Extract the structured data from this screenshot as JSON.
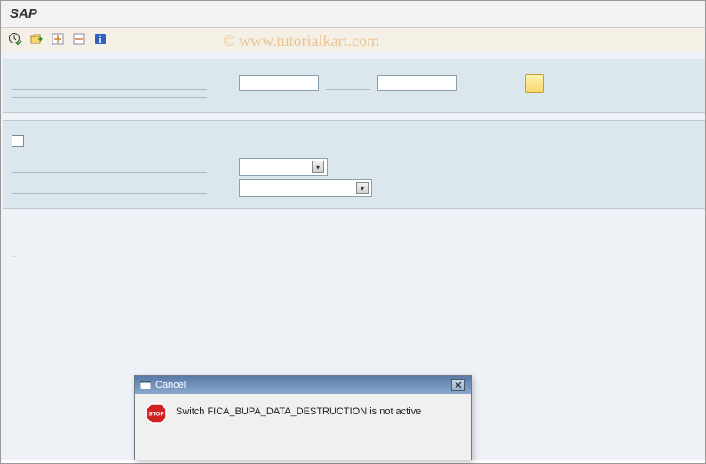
{
  "header": {
    "title": "SAP"
  },
  "watermark": "© www.tutorialkart.com",
  "toolbar": {
    "buttons": [
      "execute",
      "get-variant",
      "expand",
      "collapse",
      "info"
    ]
  },
  "panel1": {
    "field1_value": "",
    "field2_value": ""
  },
  "panel2": {
    "checkbox_checked": false,
    "dropdown1_value": "",
    "dropdown2_value": ""
  },
  "stray_text": "_",
  "dialog": {
    "title": "Cancel",
    "message": "Switch FICA_BUPA_DATA_DESTRUCTION is not active"
  }
}
